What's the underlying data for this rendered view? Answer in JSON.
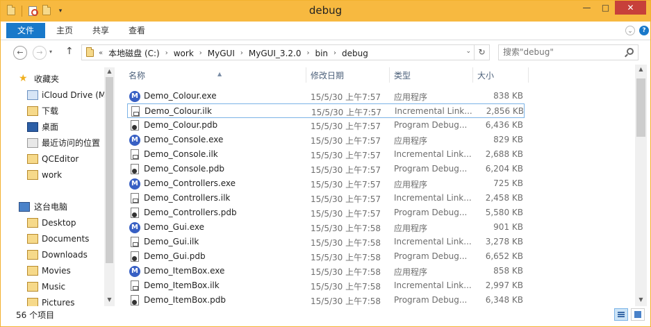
{
  "window": {
    "title": "debug",
    "buttons": {
      "minimize": "—",
      "maximize": "□",
      "close": "✕"
    }
  },
  "ribbon": {
    "tabs": [
      {
        "label": "文件"
      },
      {
        "label": "主页"
      },
      {
        "label": "共享"
      },
      {
        "label": "查看"
      }
    ],
    "help": "?",
    "expand": "⌄"
  },
  "nav": {
    "back": "←",
    "forward": "→",
    "recent": "▾",
    "up": "↑"
  },
  "address": {
    "overflow": "«",
    "crumbs": [
      "本地磁盘 (C:)",
      "work",
      "MyGUI",
      "MyGUI_3.2.0",
      "bin",
      "debug"
    ],
    "separator": "›",
    "dropdown": "⌄",
    "refresh": "↻"
  },
  "search": {
    "placeholder": "搜索\"debug\""
  },
  "sidebar": {
    "favorites_label": "收藏夹",
    "favorites": [
      {
        "label": "iCloud Drive (M",
        "icon": "cloud-drive-icon"
      },
      {
        "label": "下载",
        "icon": "downloads-icon"
      },
      {
        "label": "桌面",
        "icon": "desktop-icon"
      },
      {
        "label": "最近访问的位置",
        "icon": "recent-places-icon"
      },
      {
        "label": "QCEditor",
        "icon": "folder-icon"
      },
      {
        "label": "work",
        "icon": "folder-icon"
      }
    ],
    "pc_label": "这台电脑",
    "pc_items": [
      {
        "label": "Desktop",
        "icon": "desktop-folder-icon"
      },
      {
        "label": "Documents",
        "icon": "documents-folder-icon"
      },
      {
        "label": "Downloads",
        "icon": "downloads-folder-icon"
      },
      {
        "label": "Movies",
        "icon": "movies-folder-icon"
      },
      {
        "label": "Music",
        "icon": "music-folder-icon"
      },
      {
        "label": "Pictures",
        "icon": "pictures-folder-icon"
      }
    ]
  },
  "columns": {
    "name": "名称",
    "date": "修改日期",
    "type": "类型",
    "size": "大小"
  },
  "files": [
    {
      "name": "Demo_Colour.exe",
      "date": "15/5/30 上午7:57",
      "type": "应用程序",
      "size": "838 KB",
      "kind": "exe"
    },
    {
      "name": "Demo_Colour.ilk",
      "date": "15/5/30 上午7:57",
      "type": "Incremental Link...",
      "size": "2,856 KB",
      "kind": "ilk",
      "selected": true
    },
    {
      "name": "Demo_Colour.pdb",
      "date": "15/5/30 上午7:57",
      "type": "Program Debug...",
      "size": "6,436 KB",
      "kind": "pdb"
    },
    {
      "name": "Demo_Console.exe",
      "date": "15/5/30 上午7:57",
      "type": "应用程序",
      "size": "829 KB",
      "kind": "exe"
    },
    {
      "name": "Demo_Console.ilk",
      "date": "15/5/30 上午7:57",
      "type": "Incremental Link...",
      "size": "2,688 KB",
      "kind": "ilk"
    },
    {
      "name": "Demo_Console.pdb",
      "date": "15/5/30 上午7:57",
      "type": "Program Debug...",
      "size": "6,204 KB",
      "kind": "pdb"
    },
    {
      "name": "Demo_Controllers.exe",
      "date": "15/5/30 上午7:57",
      "type": "应用程序",
      "size": "725 KB",
      "kind": "exe"
    },
    {
      "name": "Demo_Controllers.ilk",
      "date": "15/5/30 上午7:57",
      "type": "Incremental Link...",
      "size": "2,458 KB",
      "kind": "ilk"
    },
    {
      "name": "Demo_Controllers.pdb",
      "date": "15/5/30 上午7:57",
      "type": "Program Debug...",
      "size": "5,580 KB",
      "kind": "pdb"
    },
    {
      "name": "Demo_Gui.exe",
      "date": "15/5/30 上午7:58",
      "type": "应用程序",
      "size": "901 KB",
      "kind": "exe"
    },
    {
      "name": "Demo_Gui.ilk",
      "date": "15/5/30 上午7:58",
      "type": "Incremental Link...",
      "size": "3,278 KB",
      "kind": "ilk"
    },
    {
      "name": "Demo_Gui.pdb",
      "date": "15/5/30 上午7:58",
      "type": "Program Debug...",
      "size": "6,652 KB",
      "kind": "pdb"
    },
    {
      "name": "Demo_ItemBox.exe",
      "date": "15/5/30 上午7:58",
      "type": "应用程序",
      "size": "858 KB",
      "kind": "exe"
    },
    {
      "name": "Demo_ItemBox.ilk",
      "date": "15/5/30 上午7:58",
      "type": "Incremental Link...",
      "size": "2,997 KB",
      "kind": "ilk"
    },
    {
      "name": "Demo_ItemBox.pdb",
      "date": "15/5/30 上午7:58",
      "type": "Program Debug...",
      "size": "6,348 KB",
      "kind": "pdb"
    }
  ],
  "status": {
    "count": "56 个项目"
  },
  "colors": {
    "titlebar": "#f7b940",
    "file_tab": "#1979ca",
    "selection_border": "#7bb3e6",
    "exe_icon": "#3860c4"
  }
}
